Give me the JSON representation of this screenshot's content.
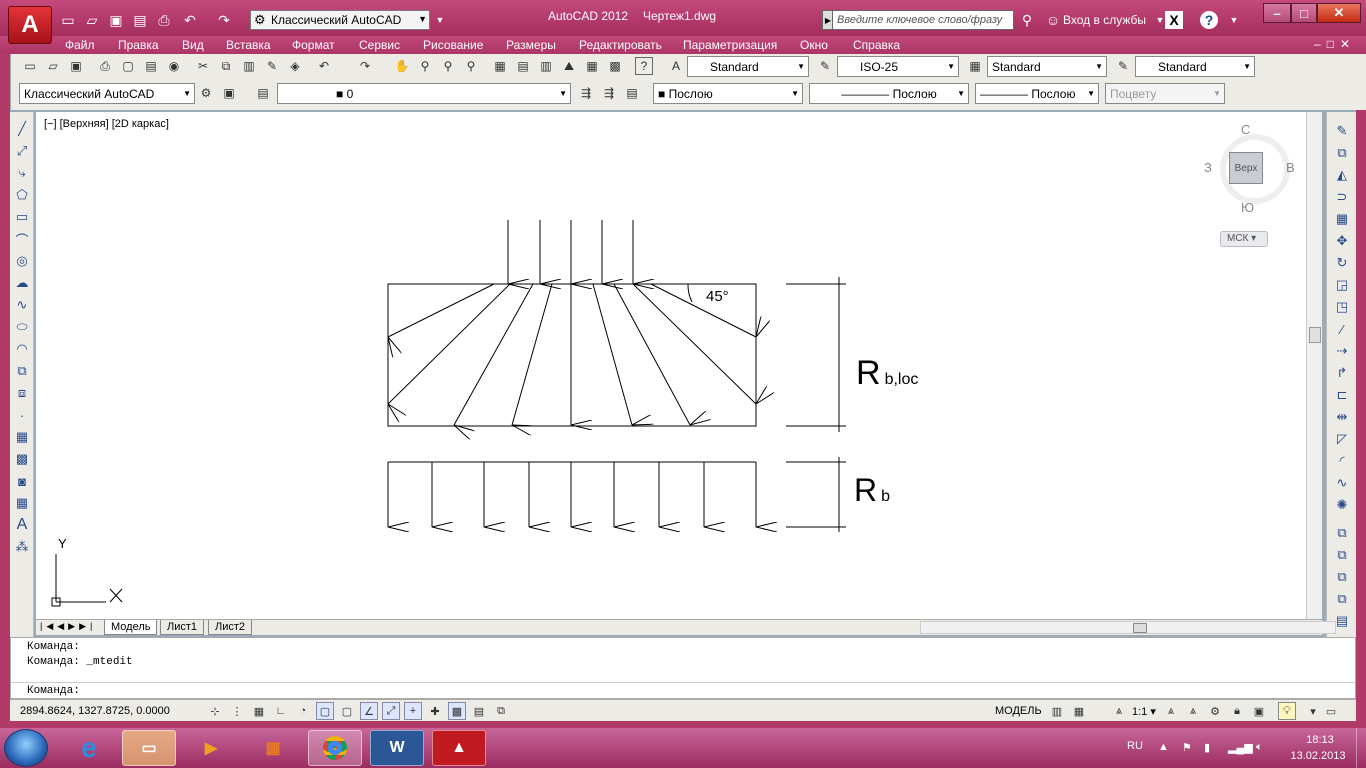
{
  "titlebar": {
    "app_title": "AutoCAD 2012",
    "file_name": "Чертеж1.dwg",
    "workspace": "Классический AutoCAD",
    "search_placeholder": "Введите ключевое слово/фразу",
    "login": "Вход в службы",
    "logo_letter": "A"
  },
  "menu": [
    "Файл",
    "Правка",
    "Вид",
    "Вставка",
    "Формат",
    "Сервис",
    "Рисование",
    "Размеры",
    "Редактировать",
    "Параметризация",
    "Окно",
    "Справка"
  ],
  "toolbars": {
    "text_style": "Standard",
    "dim_style": "ISO-25",
    "table_style": "Standard",
    "mleader_style": "Standard",
    "workspace": "Классический AutoCAD",
    "layer": "0",
    "color": "Послою",
    "linetype": "Послою",
    "lineweight": "Послою",
    "plotstyle": "Поцвету"
  },
  "viewport": {
    "label": "[−] [Верхняя] [2D каркас]",
    "viewcube": {
      "top": "Верх",
      "north": "С",
      "south": "Ю",
      "west": "З",
      "east": "В",
      "ucs": "МСК"
    },
    "ucs_x": "X",
    "ucs_y": "Y"
  },
  "drawing": {
    "angle_label": "45°",
    "label_top_main": "R",
    "label_top_sub": "b,loc",
    "label_bottom_main": "R",
    "label_bottom_sub": "b"
  },
  "tabs": [
    "Модель",
    "Лист1",
    "Лист2"
  ],
  "command": {
    "history": [
      "Команда:",
      "Команда: _mtedit"
    ],
    "prompt": "Команда:"
  },
  "status": {
    "coordinates": "2894.8624, 1327.8725, 0.0000",
    "mode": "МОДЕЛЬ",
    "scale": "1:1"
  },
  "taskbar": {
    "lang": "RU",
    "time": "18:13",
    "date": "13.02.2013",
    "word_letter": "W"
  }
}
